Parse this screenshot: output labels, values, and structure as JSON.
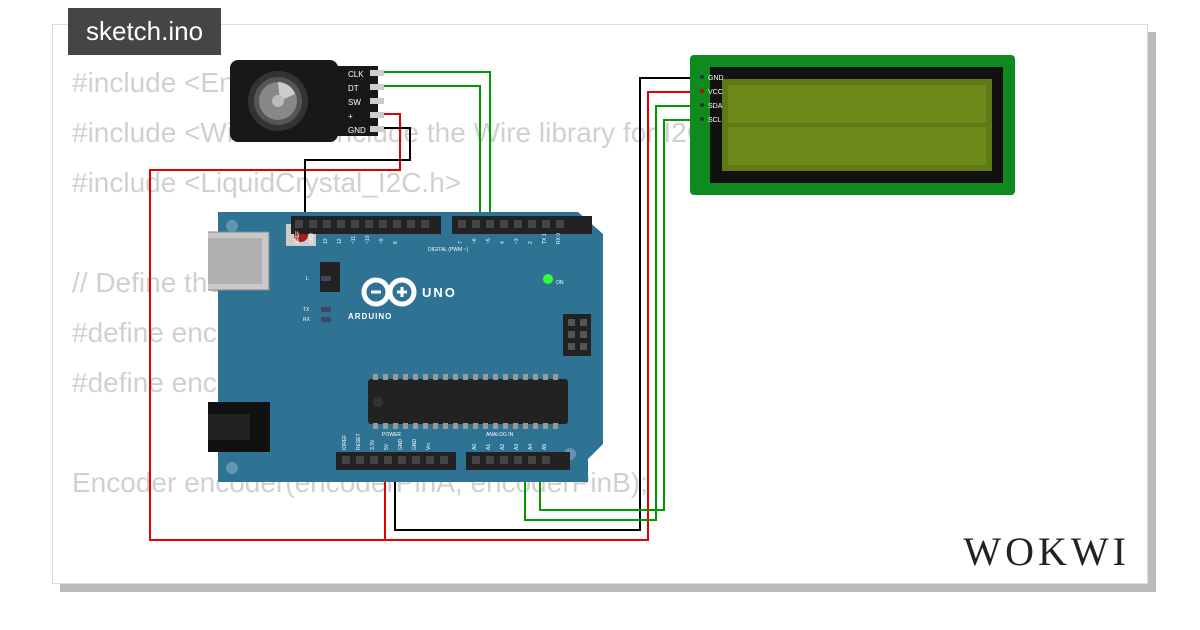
{
  "tab": {
    "title": "sketch.ino"
  },
  "logo": "WOKWI",
  "code": {
    "l1": "#include <Encoder.h>",
    "l2": "#include <Wire.h> // Include the Wire library for I2C communication",
    "l3": "#include <LiquidCrystal_I2C.h>",
    "l4": "",
    "l5": "// Define the pins for the rotary encoder",
    "l6": "#define encoderPinA 2",
    "l7": "#define encoderPinB 3",
    "l8": "",
    "l9": "Encoder encoder(encoderPinA, encoderPinB);"
  },
  "arduino": {
    "brand": "ARDUINO",
    "model": "UNO",
    "sections": {
      "digital": "DIGITAL (PWM ~)",
      "power": "POWER",
      "analog": "ANALOG IN"
    },
    "top_pins": [
      "AREF",
      "GND",
      "13",
      "12",
      "~11",
      "~10",
      "~9",
      "8",
      "",
      "7",
      "~6",
      "~5",
      "4",
      "~3",
      "2",
      "TX 1",
      "RX 0"
    ],
    "bottom_pins": [
      "IOREF",
      "RESET",
      "3.3V",
      "5V",
      "GND",
      "GND",
      "Vin",
      "",
      "A0",
      "A1",
      "A2",
      "A3",
      "A4",
      "A5"
    ],
    "led_labels": [
      "L",
      "TX",
      "RX"
    ]
  },
  "encoder": {
    "pins": [
      "CLK",
      "DT",
      "SW",
      "+",
      "GND"
    ]
  },
  "lcd": {
    "pins": [
      "GND",
      "VCC",
      "SDA",
      "SCL"
    ]
  },
  "colors": {
    "wire_red": "#e00000",
    "wire_green": "#009a00",
    "wire_black": "#000000",
    "arduino_blue": "#2E7294",
    "lcd_green": "#0f8a1f",
    "lcd_screen": "#7aa21a"
  }
}
